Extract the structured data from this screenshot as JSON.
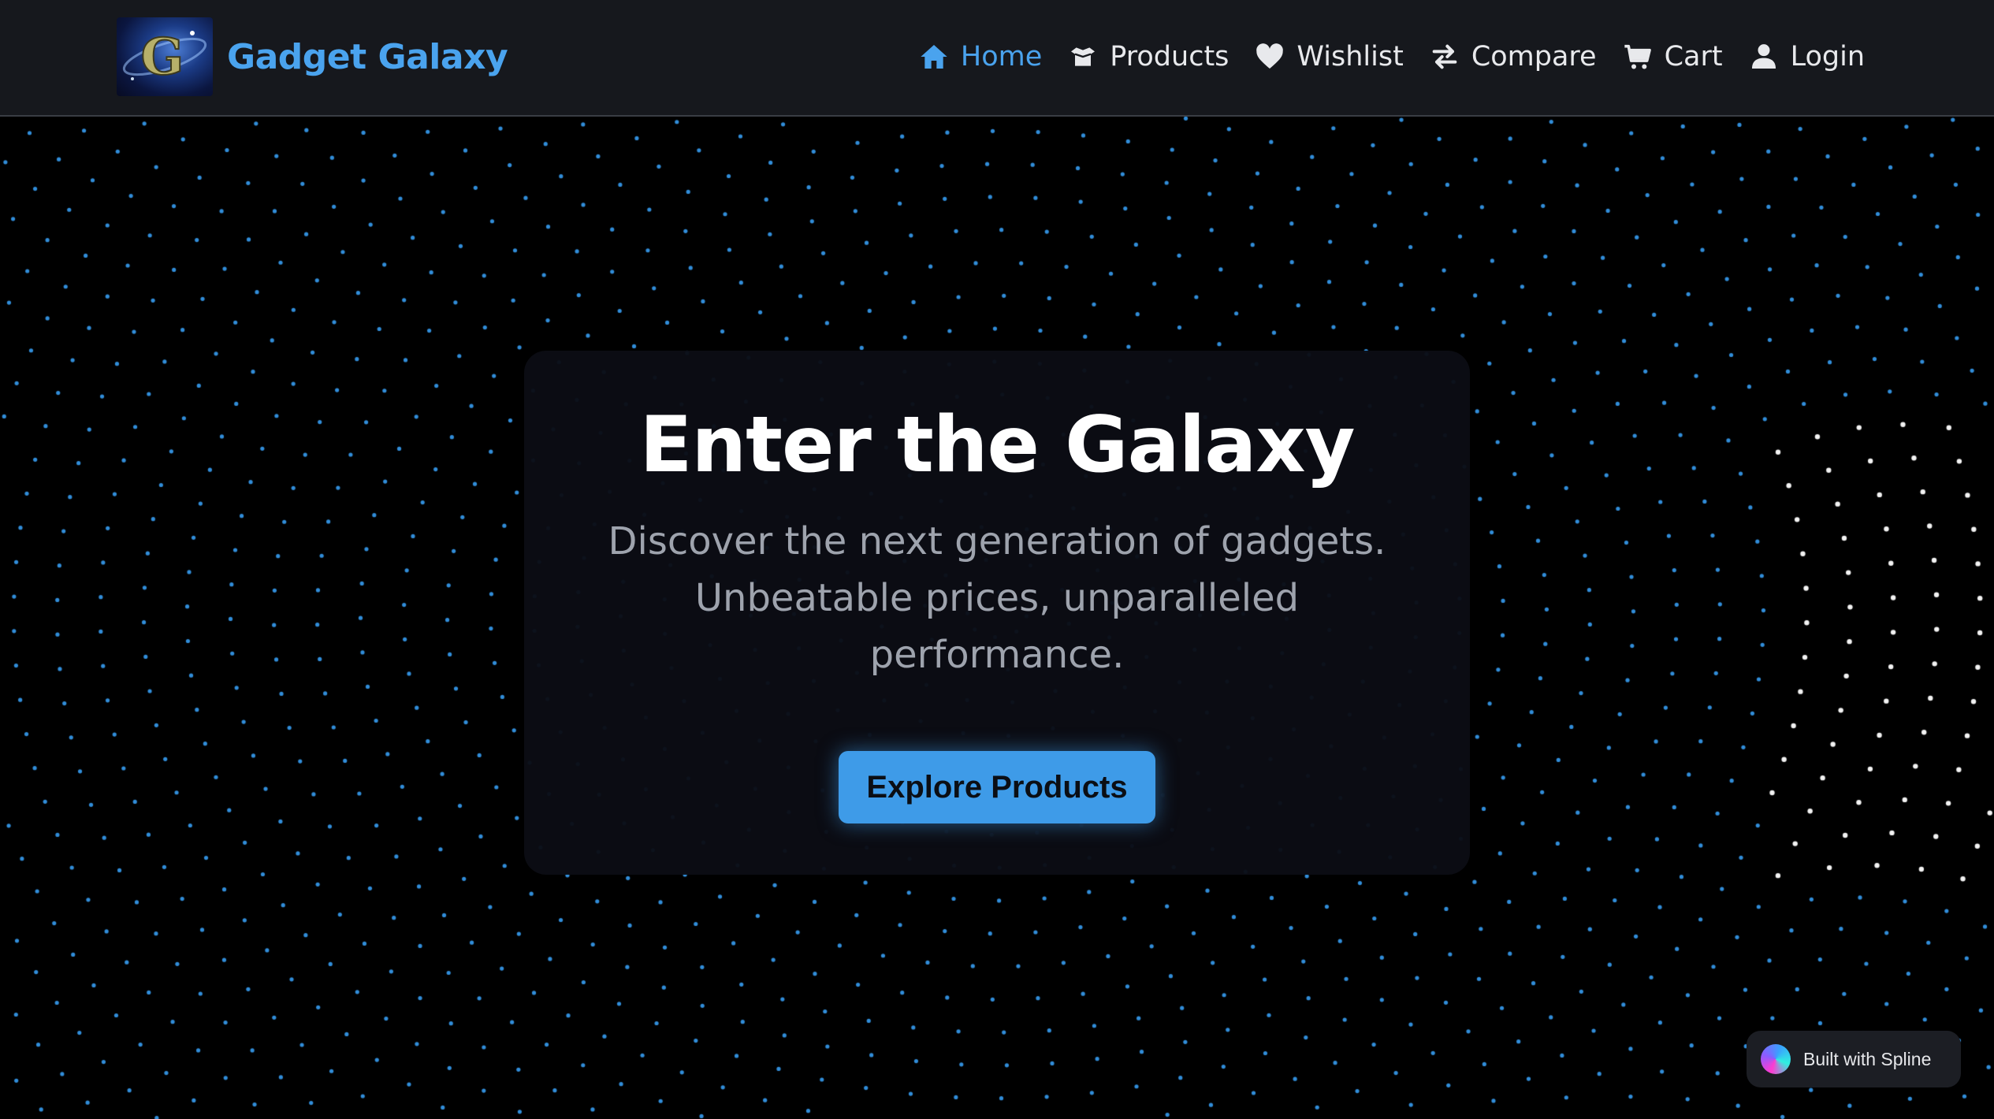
{
  "app": {
    "brand_name": "Gadget Galaxy",
    "logo_letter": "G"
  },
  "nav": {
    "items": [
      {
        "label": "Home",
        "icon": "home-icon",
        "active": true
      },
      {
        "label": "Products",
        "icon": "box-icon",
        "active": false
      },
      {
        "label": "Wishlist",
        "icon": "heart-icon",
        "active": false
      },
      {
        "label": "Compare",
        "icon": "compare-arrows-icon",
        "active": false
      },
      {
        "label": "Cart",
        "icon": "cart-icon",
        "active": false
      },
      {
        "label": "Login",
        "icon": "user-icon",
        "active": false
      }
    ]
  },
  "hero": {
    "title": "Enter the Galaxy",
    "subtitle": "Discover the next generation of gadgets. Unbeatable prices, unparalleled performance.",
    "cta_label": "Explore Products"
  },
  "badge": {
    "label": "Built with Spline"
  },
  "colors": {
    "accent": "#4aa3ee",
    "navbar_bg": "#16181d",
    "page_bg": "#000000",
    "dot_blue": "#3aa6ff",
    "dot_white": "#ffffff"
  }
}
